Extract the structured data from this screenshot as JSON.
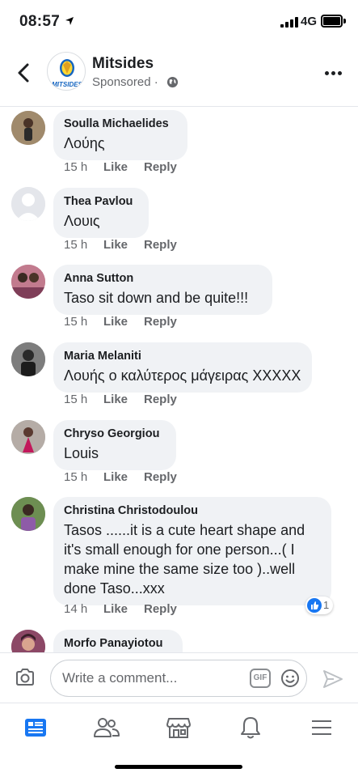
{
  "status_bar": {
    "time": "08:57",
    "network": "4G"
  },
  "header": {
    "page_name": "Mitsides",
    "logo_text": "MITSIDES",
    "sponsored": "Sponsored ·"
  },
  "actions": {
    "like": "Like",
    "reply": "Reply"
  },
  "comments": [
    {
      "author": "Soulla Michaelides",
      "text": "Λούης",
      "time": "15 h"
    },
    {
      "author": "Thea Pavlou",
      "text": "Λουις",
      "time": "15 h"
    },
    {
      "author": "Anna Sutton",
      "text": "Taso sit down and be quite!!!",
      "time": "15 h"
    },
    {
      "author": "Maria Melaniti",
      "text": "Λουής ο καλύτερος μάγειρας ΧΧΧΧΧ",
      "time": "15 h"
    },
    {
      "author": "Chryso Georgiou",
      "text": "Louis",
      "time": "15 h"
    },
    {
      "author": "Christina Christodoulou",
      "text": "Tasos ......it is a cute heart shape and\nit's small enough for one person...( I\nmake mine the same size too )..well\ndone Taso...xxx",
      "time": "14 h",
      "reactions": "1"
    },
    {
      "author": "Morfo Panayiotou",
      "text": "",
      "time": ""
    }
  ],
  "composer": {
    "placeholder": "Write a comment...",
    "gif_label": "GIF"
  },
  "colors": {
    "accent": "#1877f2",
    "bubble": "#f0f2f5",
    "secondary_text": "#65676b"
  },
  "icons": [
    "back-icon",
    "globe-icon",
    "more-icon",
    "camera-icon",
    "gif-icon",
    "emoji-icon",
    "send-icon",
    "news-feed-icon",
    "friends-icon",
    "marketplace-icon",
    "notifications-icon",
    "menu-icon"
  ]
}
